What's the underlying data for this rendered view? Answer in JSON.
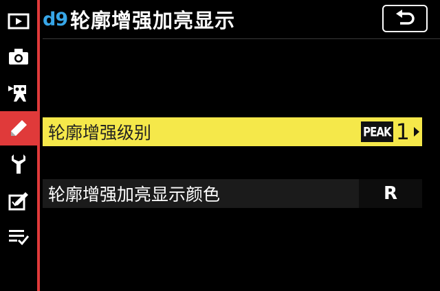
{
  "header": {
    "menu_code": "d9",
    "title": "轮廓增强加亮显示",
    "back_icon": "return-arrow-icon"
  },
  "sidebar": {
    "items": [
      {
        "icon": "playback-icon",
        "active": false
      },
      {
        "icon": "camera-icon",
        "active": false
      },
      {
        "icon": "movie-camera-icon",
        "active": false
      },
      {
        "icon": "pencil-icon",
        "active": true
      },
      {
        "icon": "wrench-icon",
        "active": false
      },
      {
        "icon": "retouch-icon",
        "active": false
      },
      {
        "icon": "my-menu-icon",
        "active": false
      }
    ],
    "active_color": "#e03a3a"
  },
  "menu": {
    "items": [
      {
        "label": "轮廓增强级别",
        "value_badge": "PEAK",
        "value": "1",
        "selected": true
      },
      {
        "label": "轮廓增强加亮显示颜色",
        "value": "R",
        "selected": false
      }
    ],
    "highlight_color": "#f5e84a"
  }
}
